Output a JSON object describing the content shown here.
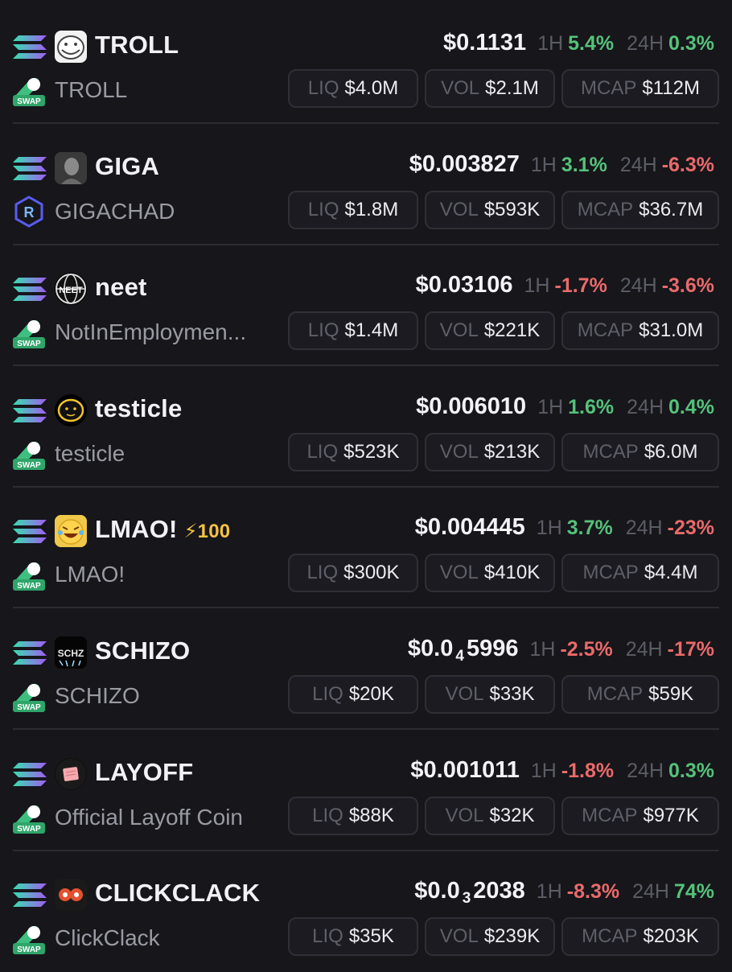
{
  "colors": {
    "positive": "#55c27a",
    "negative": "#ea6a6a",
    "boost": "#f5c242",
    "background": "#16161b"
  },
  "labels": {
    "liq": "LIQ",
    "vol": "VOL",
    "mcap": "MCAP",
    "h1": "1H",
    "h24": "24H"
  },
  "tokens": [
    {
      "symbol": "TROLL",
      "name": "TROLL",
      "price": "$0.1131",
      "h1": "5.4%",
      "h1_dir": "pos",
      "h24": "0.3%",
      "h24_dir": "pos",
      "liq": "$4.0M",
      "vol": "$2.1M",
      "mcap": "$112M",
      "dex": "swap-icon",
      "icon": "troll-face-icon"
    },
    {
      "symbol": "GIGA",
      "name": "GIGACHAD",
      "price": "$0.003827",
      "h1": "3.1%",
      "h1_dir": "pos",
      "h24": "-6.3%",
      "h24_dir": "neg",
      "liq": "$1.8M",
      "vol": "$593K",
      "mcap": "$36.7M",
      "dex": "raydium-icon",
      "icon": "gigachad-icon"
    },
    {
      "symbol": "neet",
      "name": "NotInEmploymen...",
      "price": "$0.03106",
      "h1": "-1.7%",
      "h1_dir": "neg",
      "h24": "-3.6%",
      "h24_dir": "neg",
      "liq": "$1.4M",
      "vol": "$221K",
      "mcap": "$31.0M",
      "dex": "swap-icon",
      "icon": "neet-globe-icon"
    },
    {
      "symbol": "testicle",
      "name": "testicle",
      "price": "$0.006010",
      "h1": "1.6%",
      "h1_dir": "pos",
      "h24": "0.4%",
      "h24_dir": "pos",
      "liq": "$523K",
      "vol": "$213K",
      "mcap": "$6.0M",
      "dex": "swap-icon",
      "icon": "yellow-blob-icon"
    },
    {
      "symbol": "LMAO!",
      "boost": "⚡100",
      "name": "LMAO!",
      "price": "$0.004445",
      "h1": "3.7%",
      "h1_dir": "pos",
      "h24": "-23%",
      "h24_dir": "neg",
      "liq": "$300K",
      "vol": "$410K",
      "mcap": "$4.4M",
      "dex": "swap-icon",
      "icon": "laughing-emoji-icon"
    },
    {
      "symbol": "SCHIZO",
      "name": "SCHIZO",
      "price_main": "$0.0",
      "price_sub": "4",
      "price_tail": "5996",
      "h1": "-2.5%",
      "h1_dir": "neg",
      "h24": "-17%",
      "h24_dir": "neg",
      "liq": "$20K",
      "vol": "$33K",
      "mcap": "$59K",
      "dex": "swap-icon",
      "icon": "schizo-logo-icon"
    },
    {
      "symbol": "LAYOFF",
      "name": "Official Layoff Coin",
      "price": "$0.001011",
      "h1": "-1.8%",
      "h1_dir": "neg",
      "h24": "0.3%",
      "h24_dir": "pos",
      "liq": "$88K",
      "vol": "$32K",
      "mcap": "$977K",
      "dex": "swap-icon",
      "icon": "pink-slip-icon"
    },
    {
      "symbol": "CLICKCLACK",
      "name": "ClickClack",
      "price_main": "$0.0",
      "price_sub": "3",
      "price_tail": "2038",
      "h1": "-8.3%",
      "h1_dir": "neg",
      "h24": "74%",
      "h24_dir": "pos",
      "liq": "$35K",
      "vol": "$239K",
      "mcap": "$203K",
      "dex": "swap-icon",
      "icon": "clickclack-icon"
    }
  ]
}
